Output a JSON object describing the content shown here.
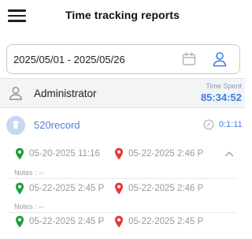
{
  "header": {
    "title": "Time tracking reports"
  },
  "filter": {
    "date_range": "2025/05/01 - 2025/05/26"
  },
  "summary": {
    "user_name": "Administrator",
    "spent_label": "Time Spent",
    "spent_value": "85:34:52"
  },
  "record": {
    "name": "520record",
    "duration": "0:1:11"
  },
  "entries": [
    {
      "start": "05-20-2025 11:16",
      "end": "05-22-2025 2:46 P",
      "notes": "Notes : --"
    },
    {
      "start": "05-22-2025 2:45 P",
      "end": "05-22-2025 2:46 P",
      "notes": "Notes : --"
    },
    {
      "start": "05-22-2025 2:45 P",
      "end": "05-22-2025 2:45 P",
      "notes": ""
    }
  ],
  "colors": {
    "accent": "#3d7fe0",
    "start_pin": "#1e9e3a",
    "end_pin": "#e53935"
  },
  "icons": {
    "menu": "hamburger-menu-icon",
    "calendar": "calendar-icon",
    "user": "user-icon",
    "timer": "timer-icon",
    "chevron": "chevron-up-icon"
  }
}
